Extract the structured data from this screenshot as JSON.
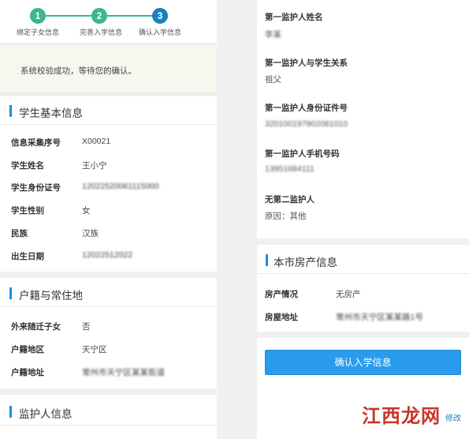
{
  "stepper": {
    "steps": [
      {
        "number": "1",
        "label": "绑定子女信息"
      },
      {
        "number": "2",
        "label": "完善入学信息"
      },
      {
        "number": "3",
        "label": "确认入学信息"
      }
    ]
  },
  "notice": {
    "text": "系统校验成功，等待您的确认。"
  },
  "student_info": {
    "title": "学生基本信息",
    "rows": [
      {
        "label": "信息采集序号",
        "value": "X00021"
      },
      {
        "label": "学生姓名",
        "value": "王小宁"
      },
      {
        "label": "学生身份证号",
        "value": "12022520061115000"
      },
      {
        "label": "学生性别",
        "value": "女"
      },
      {
        "label": "民族",
        "value": "汉族"
      },
      {
        "label": "出生日期",
        "value": "12022512022"
      }
    ]
  },
  "household": {
    "title": "户籍与常住地",
    "rows": [
      {
        "label": "外来随迁子女",
        "value": "否"
      },
      {
        "label": "户籍地区",
        "value": "天宁区"
      },
      {
        "label": "户籍地址",
        "value": "常州市天宁区某某街道"
      }
    ]
  },
  "guardian_section": {
    "title": "监护人信息"
  },
  "guardian1": {
    "name_label": "第一监护人姓名",
    "name_value": "李某",
    "relation_label": "第一监护人与学生关系",
    "relation_value": "祖父",
    "id_label": "第一监护人身份证件号",
    "id_value": "320100197902081010",
    "phone_label": "第一监护人手机号码",
    "phone_value": "13951684111",
    "no_second_label": "无第二监护人",
    "no_second_value": "原因：其他"
  },
  "property": {
    "title": "本市房产信息",
    "rows": [
      {
        "label": "房产情况",
        "value": "无房产"
      },
      {
        "label": "房屋地址",
        "value": "常州市天宁区某某路1号"
      }
    ]
  },
  "actions": {
    "confirm_label": "确认入学信息",
    "modify_label": "修改"
  },
  "watermark": {
    "text": "江西龙网"
  },
  "colors": {
    "step_done": "#3bb78f",
    "step_active": "#1a7fc1",
    "accent": "#1a8fe3",
    "button": "#2a9cee"
  }
}
